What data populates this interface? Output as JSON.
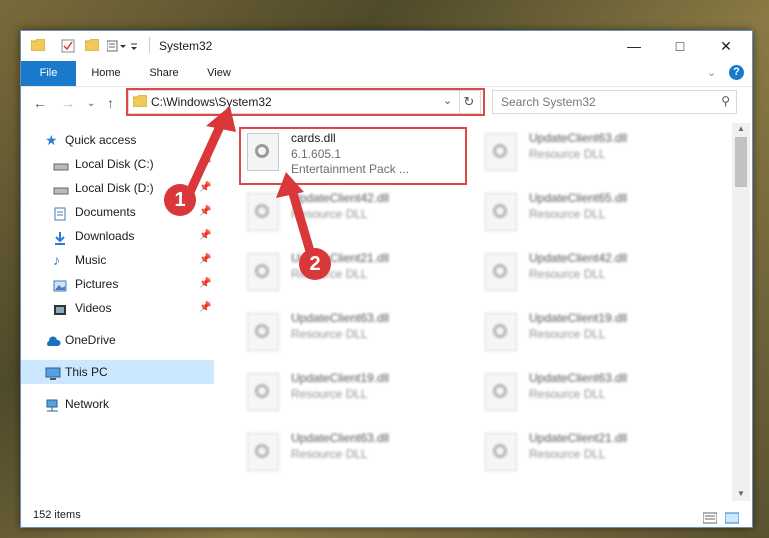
{
  "window": {
    "title": "System32"
  },
  "ribbon": {
    "tabs": [
      "File",
      "Home",
      "Share",
      "View"
    ]
  },
  "navigation": {
    "address": "C:\\Windows\\System32",
    "search_placeholder": "Search System32"
  },
  "sidebar": {
    "items": [
      {
        "label": "Quick access",
        "icon": "star-icon"
      },
      {
        "label": "Local Disk (C:)",
        "icon": "drive-icon"
      },
      {
        "label": "Local Disk (D:)",
        "icon": "drive-icon"
      },
      {
        "label": "Documents",
        "icon": "documents-icon"
      },
      {
        "label": "Downloads",
        "icon": "download-icon"
      },
      {
        "label": "Music",
        "icon": "music-icon"
      },
      {
        "label": "Pictures",
        "icon": "pictures-icon"
      },
      {
        "label": "Videos",
        "icon": "videos-icon"
      },
      {
        "label": "OneDrive",
        "icon": "cloud-icon"
      },
      {
        "label": "This PC",
        "icon": "computer-icon"
      },
      {
        "label": "Network",
        "icon": "network-icon"
      }
    ]
  },
  "files": [
    {
      "name": "cards.dll",
      "version": "6.1.605.1",
      "desc": "Entertainment Pack ..."
    },
    {
      "name": "UpdateClient63.dll",
      "desc": "Resource DLL"
    },
    {
      "name": "UpdateClient42.dll",
      "desc": "Resource DLL"
    },
    {
      "name": "UpdateClient65.dll",
      "desc": "Resource DLL"
    },
    {
      "name": "UpdateClient21.dll",
      "desc": "Resource DLL"
    },
    {
      "name": "UpdateClient42.dll",
      "desc": "Resource DLL"
    },
    {
      "name": "UpdateClient63.dll",
      "desc": "Resource DLL"
    },
    {
      "name": "UpdateClient19.dll",
      "desc": "Resource DLL"
    },
    {
      "name": "UpdateClient19.dll",
      "desc": "Resource DLL"
    },
    {
      "name": "UpdateClient63.dll",
      "desc": "Resource DLL"
    },
    {
      "name": "UpdateClient63.dll",
      "desc": "Resource DLL"
    },
    {
      "name": "UpdateClient21.dll",
      "desc": "Resource DLL"
    }
  ],
  "status": {
    "item_count": "152 items"
  },
  "annotations": [
    "1",
    "2"
  ],
  "colors": {
    "accent": "#1979ca",
    "highlight": "#e04848",
    "badge": "#d9373a"
  }
}
